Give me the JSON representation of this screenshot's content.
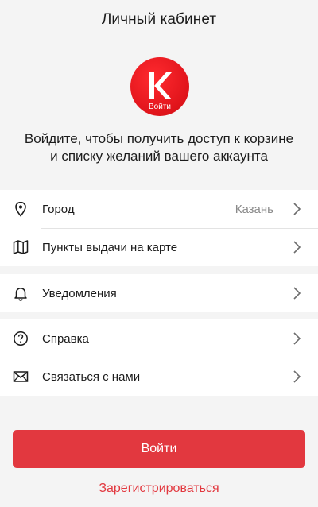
{
  "header": {
    "title": "Личный кабинет"
  },
  "logo": {
    "letter": "K",
    "label": "Войти"
  },
  "prompt": {
    "line1": "Войдите, чтобы получить доступ к корзине",
    "line2": "и списку желаний вашего аккаунта"
  },
  "menu": {
    "city": {
      "label": "Город",
      "value": "Казань",
      "icon": "location-pin-icon"
    },
    "pickup_points": {
      "label": "Пункты выдачи на карте",
      "icon": "map-icon"
    },
    "notifications": {
      "label": "Уведомления",
      "icon": "bell-icon"
    },
    "help": {
      "label": "Справка",
      "icon": "question-icon"
    },
    "contact": {
      "label": "Связаться с нами",
      "icon": "envelope-icon"
    }
  },
  "actions": {
    "login_label": "Войти",
    "register_label": "Зарегистрироваться"
  },
  "colors": {
    "accent": "#e2383f",
    "background": "#f4f4f4",
    "logo_red": "#e0141b"
  }
}
